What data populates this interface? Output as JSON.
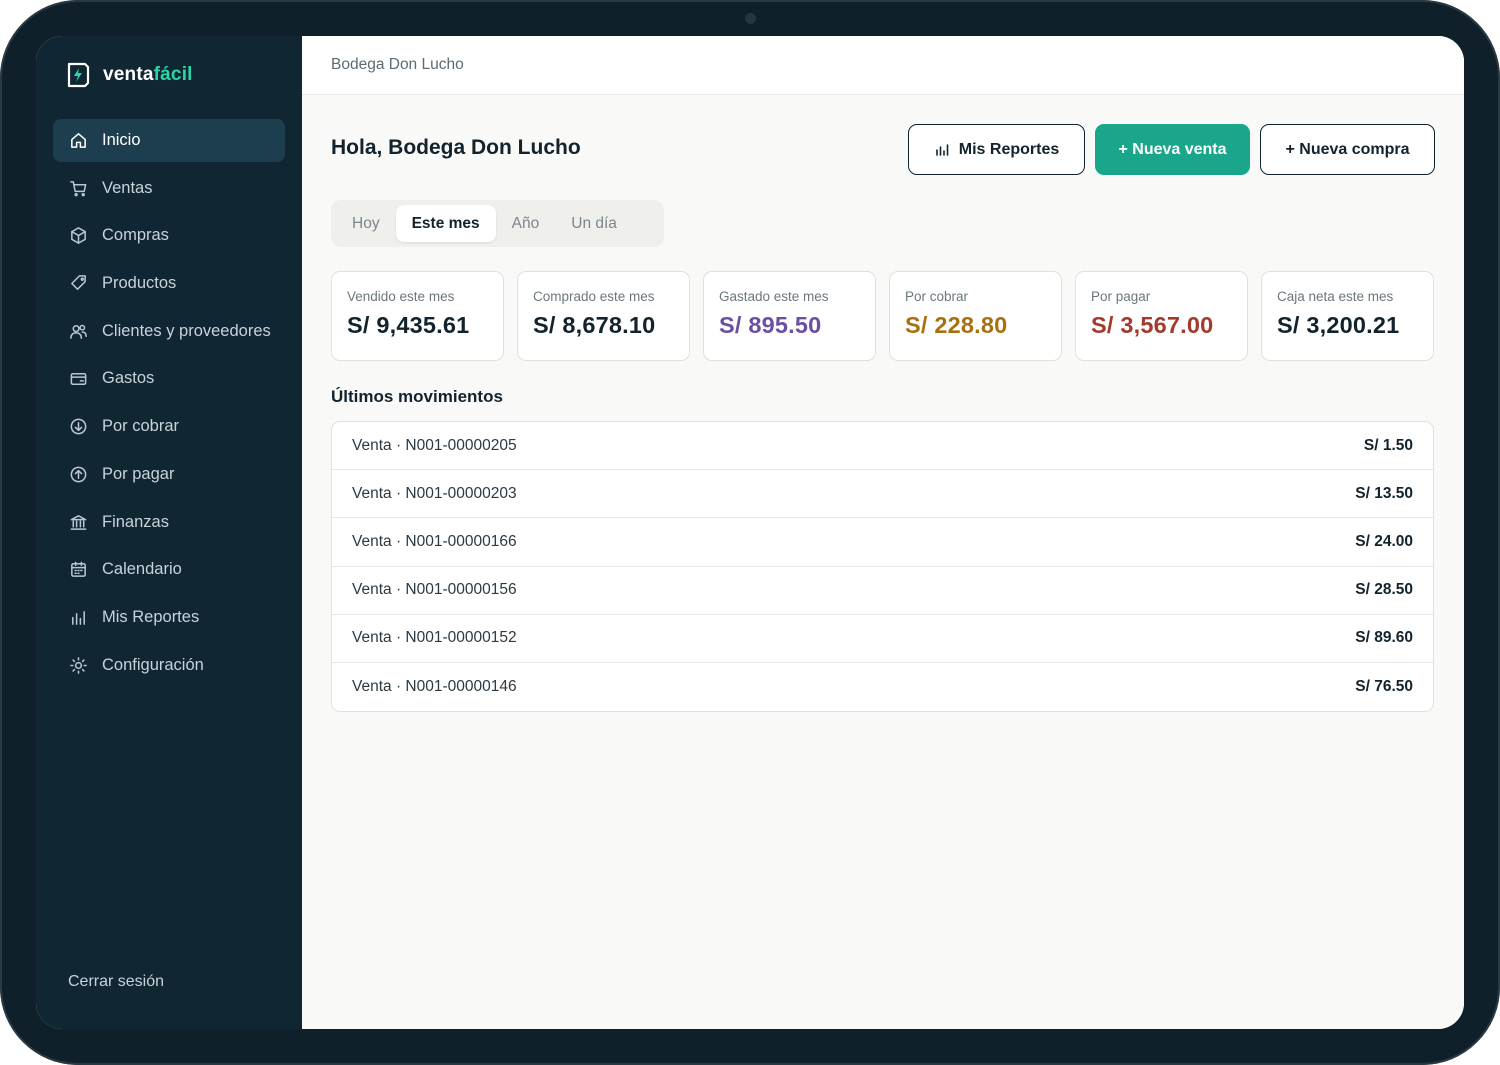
{
  "brand": {
    "name_part1": "venta",
    "name_part2": "fácil",
    "accent_color": "#2dd4a8"
  },
  "sidebar": {
    "items": [
      {
        "label": "Inicio",
        "icon": "home-icon",
        "active": true
      },
      {
        "label": "Ventas",
        "icon": "cart-icon"
      },
      {
        "label": "Compras",
        "icon": "box-icon"
      },
      {
        "label": "Productos",
        "icon": "tag-icon"
      },
      {
        "label": "Clientes y proveedores",
        "icon": "users-icon"
      },
      {
        "label": "Gastos",
        "icon": "wallet-icon"
      },
      {
        "label": "Por cobrar",
        "icon": "arrow-down-circle-icon"
      },
      {
        "label": "Por pagar",
        "icon": "arrow-up-circle-icon"
      },
      {
        "label": "Finanzas",
        "icon": "bank-icon"
      },
      {
        "label": "Calendario",
        "icon": "calendar-icon"
      },
      {
        "label": "Mis Reportes",
        "icon": "bar-chart-icon"
      },
      {
        "label": "Configuración",
        "icon": "sun-gear-icon"
      }
    ],
    "logout_label": "Cerrar sesión"
  },
  "topbar": {
    "business_name": "Bodega Don Lucho"
  },
  "header": {
    "greeting": "Hola, Bodega Don Lucho",
    "reports_button": "Mis Reportes",
    "new_sale_button": "+ Nueva venta",
    "new_purchase_button": "+ Nueva compra",
    "primary_color": "#1aa68b"
  },
  "period_tabs": {
    "tabs": [
      "Hoy",
      "Este mes",
      "Año",
      "Un día"
    ],
    "selected": "Este mes"
  },
  "kpis": [
    {
      "label": "Vendido este mes",
      "value": "S/ 9,435.61",
      "color": "#13232d"
    },
    {
      "label": "Comprado este mes",
      "value": "S/ 8,678.10",
      "color": "#13232d"
    },
    {
      "label": "Gastado este mes",
      "value": "S/ 895.50",
      "color": "#6a4fa3"
    },
    {
      "label": "Por cobrar",
      "value": "S/ 228.80",
      "color": "#a8700f"
    },
    {
      "label": "Por pagar",
      "value": "S/ 3,567.00",
      "color": "#a33a2e"
    },
    {
      "label": "Caja neta este mes",
      "value": "S/ 3,200.21",
      "color": "#13232d"
    }
  ],
  "movements": {
    "title": "Últimos movimientos",
    "rows": [
      {
        "description": "Venta · N001-00000205",
        "amount": "S/ 1.50"
      },
      {
        "description": "Venta · N001-00000203",
        "amount": "S/ 13.50"
      },
      {
        "description": "Venta · N001-00000166",
        "amount": "S/ 24.00"
      },
      {
        "description": "Venta · N001-00000156",
        "amount": "S/ 28.50"
      },
      {
        "description": "Venta · N001-00000152",
        "amount": "S/ 89.60"
      },
      {
        "description": "Venta · N001-00000146",
        "amount": "S/ 76.50"
      }
    ]
  }
}
